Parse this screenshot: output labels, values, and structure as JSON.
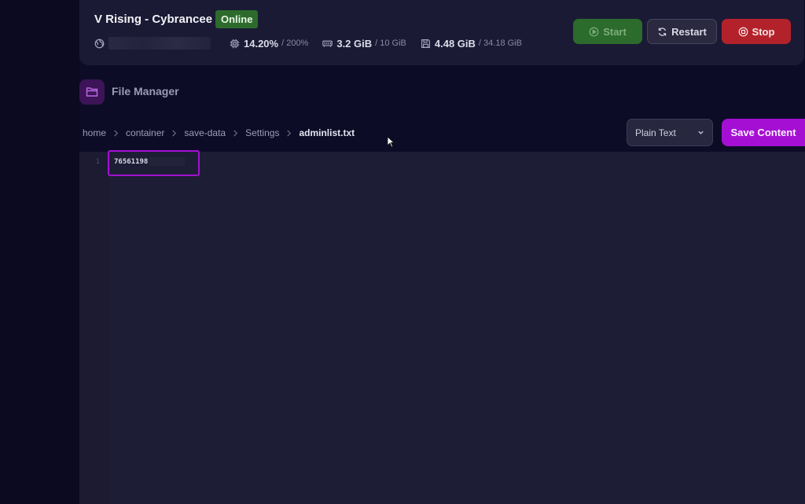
{
  "server": {
    "name": "V Rising - Cybrancee",
    "status": "Online",
    "stats": {
      "cpu_value": "14.20%",
      "cpu_limit": "/ 200%",
      "memory_value": "3.2 GiB",
      "memory_limit": "/ 10 GiB",
      "disk_value": "4.48 GiB",
      "disk_limit": "/ 34.18 GiB"
    },
    "actions": {
      "start_label": "Start",
      "restart_label": "Restart",
      "stop_label": "Stop"
    }
  },
  "file_manager": {
    "title": "File Manager",
    "breadcrumb": [
      "home",
      "container",
      "save-data",
      "Settings",
      "adminlist.txt"
    ],
    "mode_select": "Plain Text",
    "save_label": "Save Content"
  },
  "editor": {
    "lines": [
      {
        "number": "1",
        "text": "76561198"
      }
    ]
  },
  "colors": {
    "accent": "#a50fd3",
    "online": "#2d6b2c",
    "stop": "#b3222a",
    "start": "#2b6b2b"
  }
}
